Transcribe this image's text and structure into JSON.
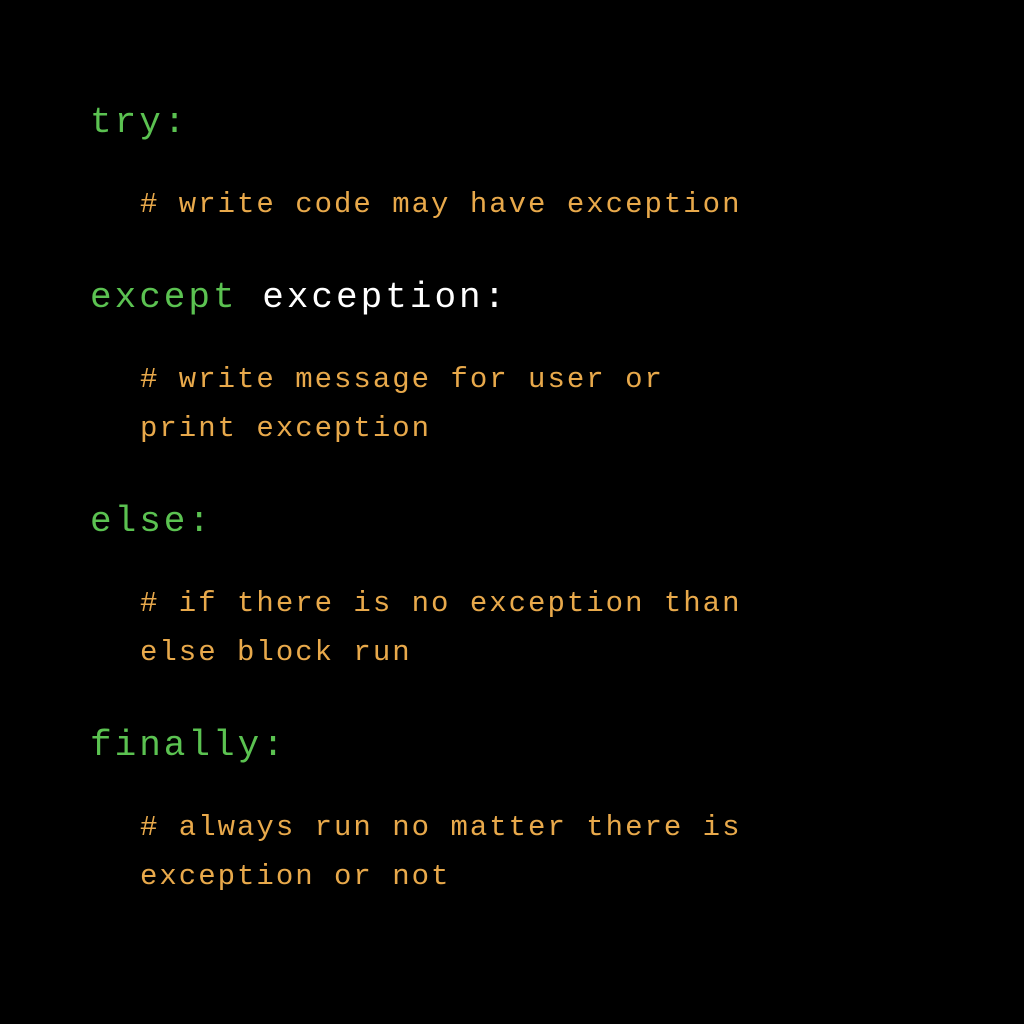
{
  "code": {
    "try": {
      "keyword": "try:",
      "comment": "# write code may have exception"
    },
    "except": {
      "keyword": "except",
      "identifier": " exception:",
      "comment_line1": "# write message for user or",
      "comment_line2": "print exception"
    },
    "else": {
      "keyword": "else:",
      "comment_line1": "# if there is no exception than",
      "comment_line2": "else block run"
    },
    "finally": {
      "keyword": "finally:",
      "comment_line1": "# always run no matter there is",
      "comment_line2": "exception or not"
    }
  },
  "colors": {
    "background": "#000000",
    "keyword": "#5bc251",
    "identifier": "#ffffff",
    "comment": "#e8a94b"
  }
}
